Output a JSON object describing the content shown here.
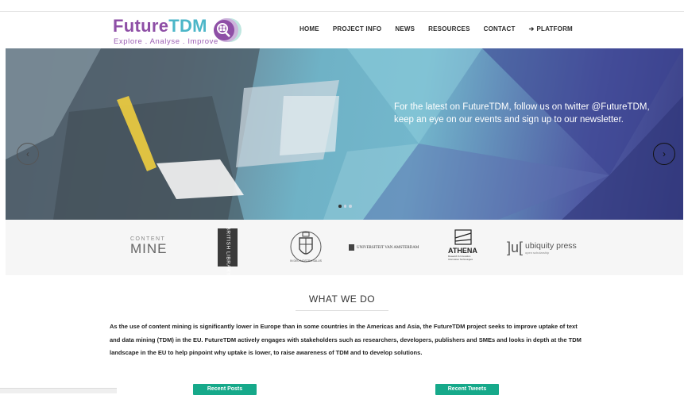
{
  "logo": {
    "title_part1": "Future",
    "title_part2": "TDM",
    "tagline": "Explore . Analyse . Improve",
    "icon": "magnifier-people-icon"
  },
  "nav": {
    "items": [
      "HOME",
      "PROJECT INFO",
      "NEWS",
      "RESOURCES",
      "CONTACT"
    ],
    "platform_label": "PLATFORM",
    "platform_icon": "sign-in-icon"
  },
  "slider": {
    "text": "For the latest on FutureTDM, follow us on twitter @FutureTDM, keep an eye on our events and sign up to our newsletter.",
    "prev_icon": "chevron-left-icon",
    "next_icon": "chevron-right-icon",
    "dots": 3,
    "active_dot": 0
  },
  "partners": {
    "contentmine_top": "CONTENT",
    "contentmine_bottom": "MINE",
    "british_library": "BRITISH LIBRARY",
    "radboud": "IN DEO NOSTRA SALUS",
    "uva": "UNIVERSITEIT VAN AMSTERDAM",
    "athena": "ATHENA",
    "athena_sub1": "Research & Innovation",
    "athena_sub2": "Information Technologies",
    "ubiquity": "ubiquity press",
    "ubiquity_sub": "open scholarship"
  },
  "what_we_do": {
    "title": "WHAT WE DO",
    "body": "As the use of content mining is significantly lower in Europe than in some countries in the Americas and Asia, the FutureTDM project seeks to improve uptake of text and data mining (TDM) in the EU. FutureTDM actively engages with stakeholders such as researchers, developers, publishers and SMEs and looks in depth at the TDM landscape in the EU to help pinpoint why uptake is lower, to raise awareness of TDM and to develop solutions."
  },
  "buttons": {
    "recent_posts": "Recent Posts",
    "recent_tweets": "Recent Tweets"
  }
}
